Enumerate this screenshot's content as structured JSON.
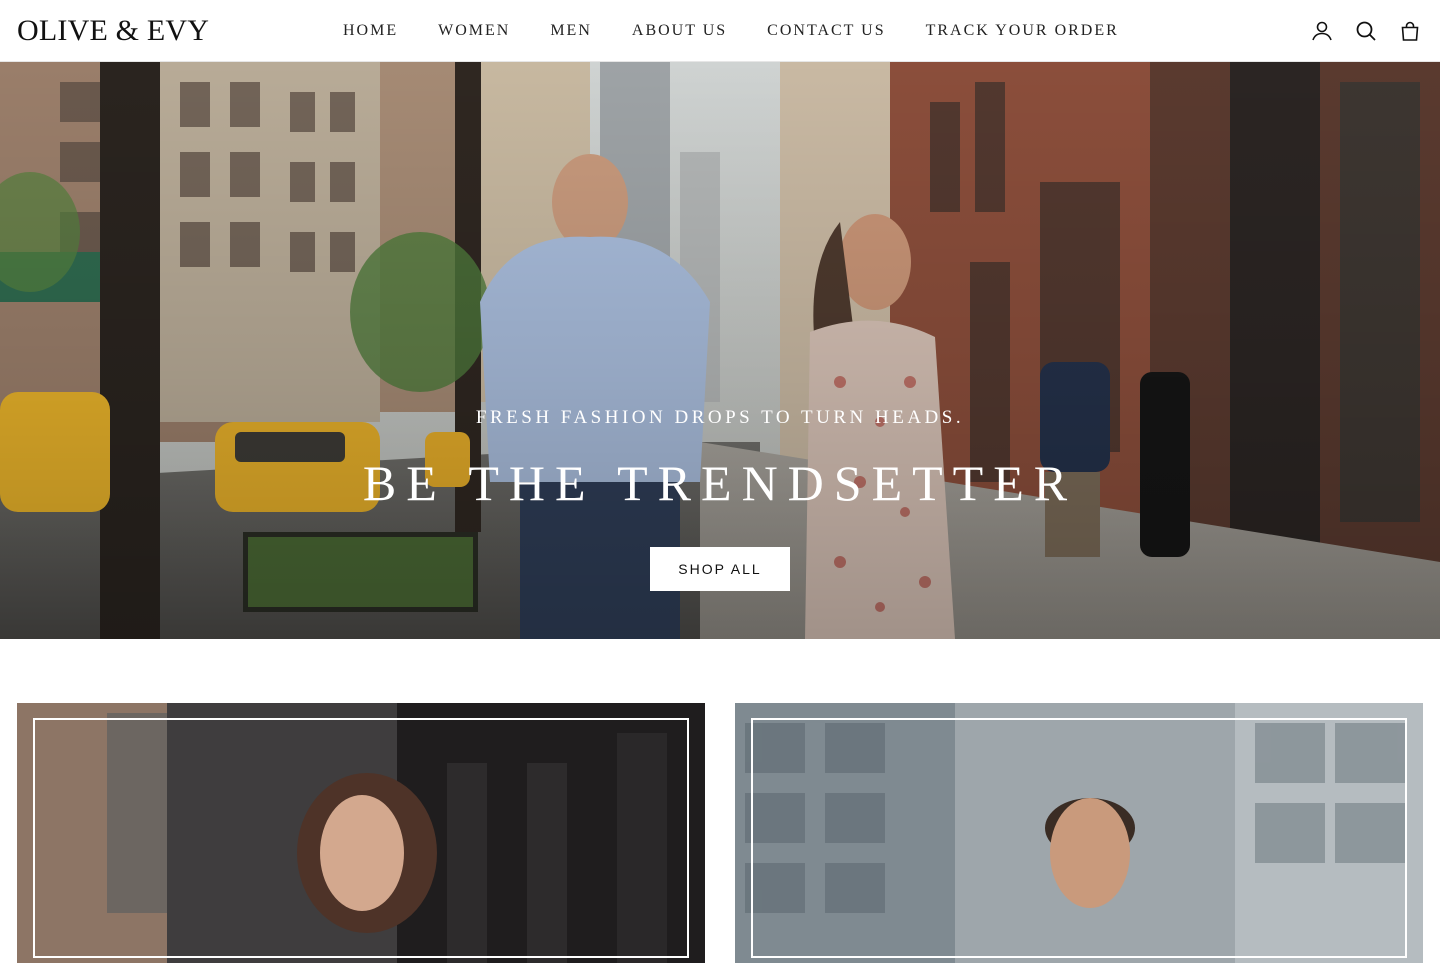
{
  "brand": {
    "logo": "OLIVE & EVY"
  },
  "nav": {
    "items": [
      {
        "label": "HOME"
      },
      {
        "label": "WOMEN"
      },
      {
        "label": "MEN"
      },
      {
        "label": "ABOUT US"
      },
      {
        "label": "CONTACT US"
      },
      {
        "label": "TRACK YOUR ORDER"
      }
    ]
  },
  "header_icons": [
    "account-icon",
    "search-icon",
    "bag-icon"
  ],
  "hero": {
    "subtitle": "FRESH FASHION DROPS TO TURN HEADS.",
    "title": "BE THE TRENDSETTER",
    "cta": "SHOP ALL"
  },
  "colors": {
    "text": "#1c1c1c",
    "background": "#ffffff",
    "button": "#ffffff",
    "taxi": "#e9b32a"
  }
}
